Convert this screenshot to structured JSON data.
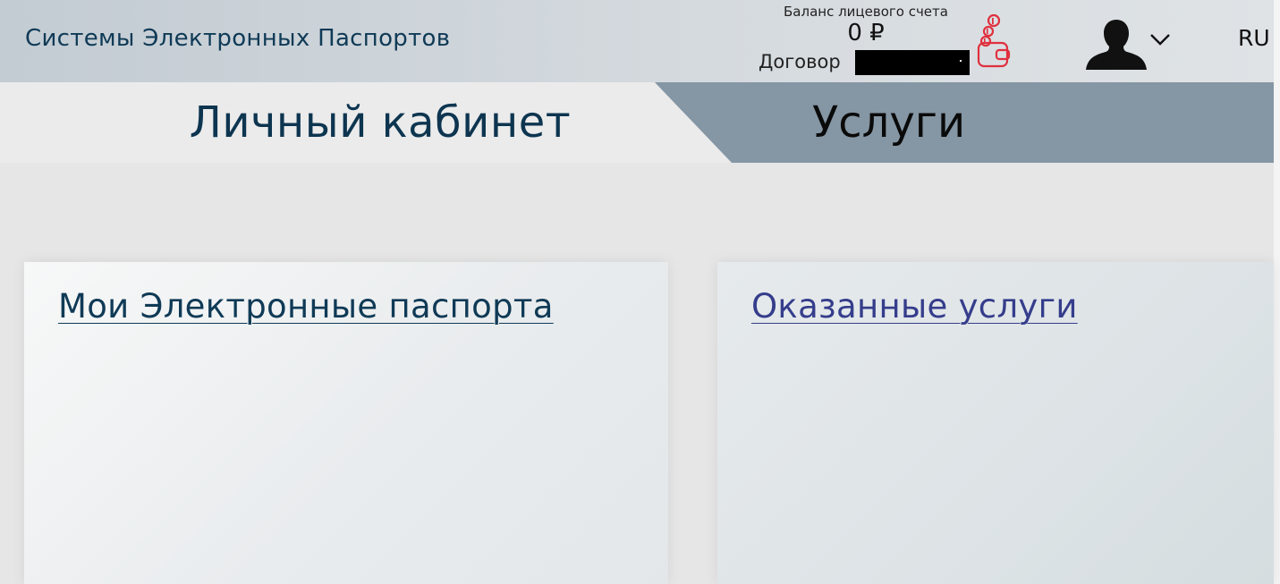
{
  "header": {
    "site_title": "Системы Электронных Паспортов",
    "balance_label": "Баланс лицевого счета",
    "balance_value": "0 ₽",
    "contract_label": "Договор",
    "contract_value": "",
    "wallet_icon": "wallet-coins-icon",
    "avatar_icon": "user-silhouette-icon",
    "menu_icon": "chevron-down-icon",
    "language": "RU"
  },
  "tabs": [
    {
      "label": "Личный кабинет",
      "active": true
    },
    {
      "label": "Услуги",
      "active": false
    }
  ],
  "cards": [
    {
      "link_text": "Мои Электронные паспорта"
    },
    {
      "link_text": "Оказанные услуги"
    }
  ],
  "colors": {
    "title_text": "#0f3a56",
    "services_tab_bg": "#8596a4",
    "wallet_icon": "#e0303e",
    "services_link": "#353d8c"
  }
}
